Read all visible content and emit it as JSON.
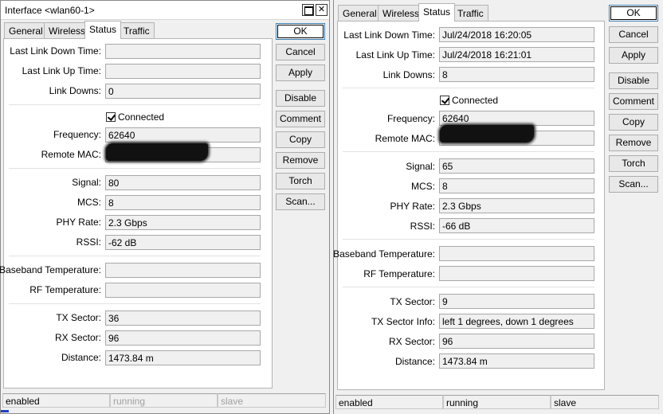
{
  "left_window": {
    "title": "Interface <wlan60-1>",
    "tabs": [
      "General",
      "Wireless",
      "Status",
      "Traffic"
    ],
    "active_tab": "Status",
    "fields": {
      "last_link_down_label": "Last Link Down Time:",
      "last_link_down_value": "",
      "last_link_up_label": "Last Link Up Time:",
      "last_link_up_value": "",
      "link_downs_label": "Link Downs:",
      "link_downs_value": "0",
      "connected_label": "Connected",
      "frequency_label": "Frequency:",
      "frequency_value": "62640",
      "remote_mac_label": "Remote MAC:",
      "signal_label": "Signal:",
      "signal_value": "80",
      "mcs_label": "MCS:",
      "mcs_value": "8",
      "phy_rate_label": "PHY Rate:",
      "phy_rate_value": "2.3 Gbps",
      "rssi_label": "RSSI:",
      "rssi_value": "-62 dB",
      "baseband_temp_label": "Baseband Temperature:",
      "baseband_temp_value": "",
      "rf_temp_label": "RF Temperature:",
      "rf_temp_value": "",
      "tx_sector_label": "TX Sector:",
      "tx_sector_value": "36",
      "rx_sector_label": "RX Sector:",
      "rx_sector_value": "96",
      "distance_label": "Distance:",
      "distance_value": "1473.84 m"
    },
    "buttons": {
      "ok": "OK",
      "cancel": "Cancel",
      "apply": "Apply",
      "disable": "Disable",
      "comment": "Comment",
      "copy": "Copy",
      "remove": "Remove",
      "torch": "Torch",
      "scan": "Scan..."
    },
    "status_bar": [
      "enabled",
      "running",
      "slave"
    ]
  },
  "right_window": {
    "tabs": [
      "General",
      "Wireless",
      "Status",
      "Traffic"
    ],
    "active_tab": "Status",
    "fields": {
      "last_link_down_label": "Last Link Down Time:",
      "last_link_down_value": "Jul/24/2018 16:20:05",
      "last_link_up_label": "Last Link Up Time:",
      "last_link_up_value": "Jul/24/2018 16:21:01",
      "link_downs_label": "Link Downs:",
      "link_downs_value": "8",
      "connected_label": "Connected",
      "frequency_label": "Frequency:",
      "frequency_value": "62640",
      "remote_mac_label": "Remote MAC:",
      "signal_label": "Signal:",
      "signal_value": "65",
      "mcs_label": "MCS:",
      "mcs_value": "8",
      "phy_rate_label": "PHY Rate:",
      "phy_rate_value": "2.3 Gbps",
      "rssi_label": "RSSI:",
      "rssi_value": "-66 dB",
      "baseband_temp_label": "Baseband Temperature:",
      "baseband_temp_value": "",
      "rf_temp_label": "RF Temperature:",
      "rf_temp_value": "",
      "tx_sector_label": "TX Sector:",
      "tx_sector_value": "9",
      "tx_sector_info_label": "TX Sector Info:",
      "tx_sector_info_value": "left 1 degrees, down 1 degrees",
      "rx_sector_label": "RX Sector:",
      "rx_sector_value": "96",
      "distance_label": "Distance:",
      "distance_value": "1473.84 m"
    },
    "buttons": {
      "ok": "OK",
      "cancel": "Cancel",
      "apply": "Apply",
      "disable": "Disable",
      "comment": "Comment",
      "copy": "Copy",
      "remove": "Remove",
      "torch": "Torch",
      "scan": "Scan..."
    },
    "status_bar": [
      "enabled",
      "running",
      "slave"
    ]
  },
  "colors": {
    "window_bg": "#f0f0f0",
    "panel_bg": "#ffffff",
    "field_bg": "#f0f0f0",
    "disabled_text": "#a0a0a0",
    "redaction": "#111111"
  },
  "icons": [
    "maximize-icon",
    "close-icon",
    "checkbox-checked-icon"
  ]
}
